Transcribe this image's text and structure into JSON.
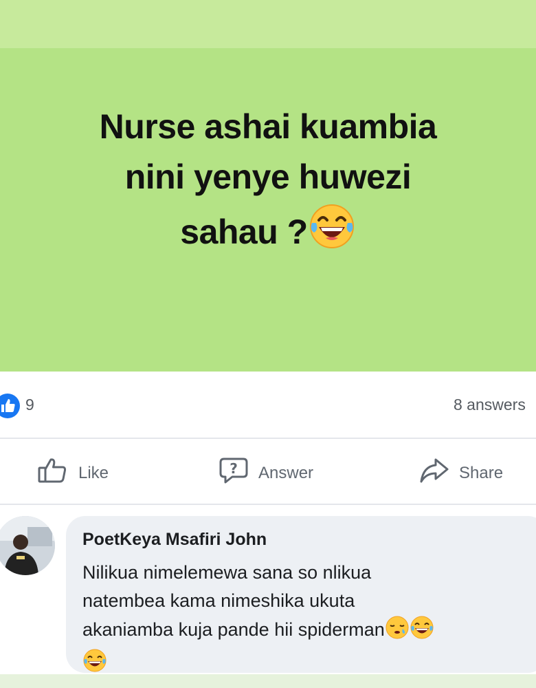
{
  "post": {
    "text_lines": [
      "Nurse ashai kuambia",
      "nini yenye huwezi",
      "sahau ?"
    ],
    "emoji": "face-with-tears-of-joy",
    "background_color": "#b4e385"
  },
  "stats": {
    "like_count": "9",
    "answers": "8 answers"
  },
  "actions": {
    "like_label": "Like",
    "answer_label": "Answer",
    "share_label": "Share"
  },
  "comment": {
    "author": "PoetKeya Msafiri John",
    "text_lines": [
      "Nilikua nimelemewa sana so nlikua",
      "natembea kama nimeshika ukuta",
      "akaniamba kuja pande hii spiderman",
      ""
    ],
    "emojis": [
      "sleepy-face",
      "face-with-tears-of-joy",
      "face-with-tears-of-joy"
    ]
  },
  "colors": {
    "like_blue": "#1877f2",
    "muted_text": "#606770"
  }
}
